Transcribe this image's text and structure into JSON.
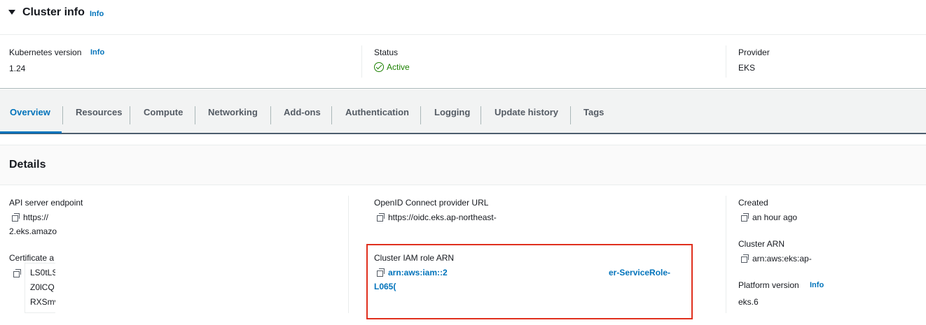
{
  "cluster_info": {
    "title": "Cluster info",
    "info_label": "Info"
  },
  "summary": {
    "kubernetes_version_label": "Kubernetes version",
    "kubernetes_version_info": "Info",
    "kubernetes_version_value": "1.24",
    "status_label": "Status",
    "status_value": "Active",
    "provider_label": "Provider",
    "provider_value": "EKS"
  },
  "tabs": [
    "Overview",
    "Resources",
    "Compute",
    "Networking",
    "Add-ons",
    "Authentication",
    "Logging",
    "Update history",
    "Tags"
  ],
  "active_tab": "Overview",
  "details": {
    "title": "Details",
    "api_endpoint_label": "API server endpoint",
    "api_endpoint_line1": "https://",
    "api_endpoint_line2": "2.eks.amazo",
    "certificate_label": "Certificate a",
    "certificate_lines": [
      "LS0tLS",
      "Z0lCQ",
      "RXSmv"
    ],
    "oidc_label": "OpenID Connect provider URL",
    "oidc_value": "https://oidc.eks.ap-northeast-",
    "iam_role_label": "Cluster IAM role ARN",
    "iam_role_part1": "arn:aws:iam::2",
    "iam_role_part2": "er-ServiceRole-",
    "iam_role_line2": "L065(",
    "created_label": "Created",
    "created_value": "an hour ago",
    "cluster_arn_label": "Cluster ARN",
    "cluster_arn_value": "arn:aws:eks:ap-",
    "platform_version_label": "Platform version",
    "platform_version_info": "Info",
    "platform_version_value": "eks.6"
  },
  "colors": {
    "link": "#0073bb",
    "active_status": "#1d8102",
    "highlight_border": "#e0301e"
  }
}
